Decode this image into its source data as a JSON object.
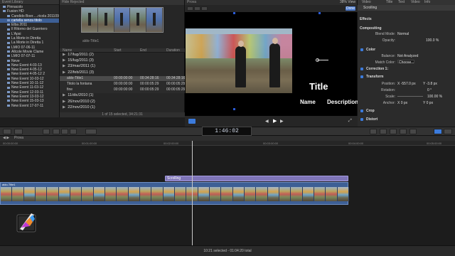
{
  "library": {
    "header": "Event Library",
    "items": [
      {
        "label": "Pinnacolo",
        "level": 1
      },
      {
        "label": "Fusion HD",
        "level": 1
      },
      {
        "label": "Candido Boer.....ricola 20110928",
        "level": 2
      },
      {
        "label": "cartella senza titolo",
        "level": 2,
        "selected": true
      },
      {
        "label": "Elba 2011",
        "level": 2
      },
      {
        "label": "Il Ritorno del Guerriero",
        "level": 2
      },
      {
        "label": "L'Apsi",
        "level": 2
      },
      {
        "label": "La Morte in Diretta",
        "level": 2
      },
      {
        "label": "La Morte in Diretta 1",
        "level": 2
      },
      {
        "label": "LMIO 07-06-11",
        "level": 2
      },
      {
        "label": "Allcole Movie Clame",
        "level": 2
      },
      {
        "label": "LMIO 07-07-11",
        "level": 2
      },
      {
        "label": "Neve",
        "level": 2
      },
      {
        "label": "New Event 4-03-13",
        "level": 2
      },
      {
        "label": "New Event 4-05-12",
        "level": 2
      },
      {
        "label": "New Event 4-05-12 2",
        "level": 2
      },
      {
        "label": "New Event 10-03-12",
        "level": 2
      },
      {
        "label": "New Event 10-11-12",
        "level": 2
      },
      {
        "label": "New Event 11-03-12",
        "level": 2
      },
      {
        "label": "New Event 12-03-11",
        "level": 2
      },
      {
        "label": "New Event 13-03-12",
        "level": 2
      },
      {
        "label": "New Event 15-03-13",
        "level": 2
      },
      {
        "label": "New Event 17-07-11",
        "level": 2
      }
    ]
  },
  "browser": {
    "header": "Hide Rejected",
    "filmstrip_label": "aldo-Title1",
    "columns": [
      "Name",
      "Start",
      "End",
      "Duration"
    ],
    "rows": [
      {
        "type": "date",
        "name": "17/lug/2011  (2)"
      },
      {
        "type": "date",
        "name": "15/lug/2011  (3)"
      },
      {
        "type": "date",
        "name": "23/mar/2011  (1)"
      },
      {
        "type": "date",
        "name": "22/feb/2011  (3)"
      },
      {
        "type": "clip",
        "name": "aldo-Title1",
        "start": "00:00:00:00",
        "end": "00:34:28:16",
        "duration": "00:34:28:16",
        "selected": true
      },
      {
        "type": "clip",
        "name": "Titolo la fontana",
        "start": "00:00:00:00",
        "end": "00:00:05:29",
        "duration": "00:00:05:29"
      },
      {
        "type": "clip",
        "name": "fine",
        "start": "00:00:00:00",
        "end": "00:00:05:29",
        "duration": "00:00:05:29"
      },
      {
        "type": "date",
        "name": "11/dic/2010  (1)"
      },
      {
        "type": "date",
        "name": "26/nov/2010  (2)"
      },
      {
        "type": "date",
        "name": "22/nov/2010  (1)"
      }
    ],
    "footer": "1 of 15 selected, 34:21:31"
  },
  "viewer": {
    "header": "Prova",
    "zoom": "38%",
    "view": "View",
    "done": "Done",
    "title_text": "Title",
    "name_text": "Name",
    "desc_text": "Description"
  },
  "inspector": {
    "tabs": [
      "Video",
      "Title",
      "Text",
      "Video",
      "Info"
    ],
    "clip_name": "Scrolling",
    "sections": {
      "effects": "Effects",
      "compositing": "Compositing",
      "blend_mode_label": "Blend Mode:",
      "blend_mode_value": "Normal",
      "opacity_label": "Opacity:",
      "opacity_value": "100.0 %",
      "color": "Color",
      "balance_label": "Balance:",
      "balance_value": "Not Analyzed",
      "match_color_label": "Match Color:",
      "match_color_value": "Choose...",
      "correction": "Correction 1:",
      "transform": "Transform",
      "position_label": "Position:",
      "position_x": "X  -557.0 px",
      "position_y": "Y  -3.8 px",
      "rotation_label": "Rotation:",
      "rotation_value": "0 °",
      "scale_label": "Scale:",
      "scale_value": "100.00 %",
      "anchor_label": "Anchor:",
      "anchor_x": "X  0 px",
      "anchor_y": "Y  0 px",
      "crop": "Crop",
      "distort": "Distort"
    }
  },
  "toolbar": {
    "timecode": "1:46:02"
  },
  "timeline": {
    "project": "Prova",
    "ruler": [
      "00:00:00:00",
      "00:01:00:00",
      "00:02:00:00",
      "00:03:00:00",
      "00:04:00:00",
      "00:05:00:00"
    ],
    "title_clip": "Scrolling",
    "story_clip": "aldo-Title1",
    "status": "10:21 selected - 01:04:20 total"
  },
  "colors": {
    "selection": "#3d5f95",
    "title_clip": "#7f75b8",
    "accent": "#4b78c9"
  }
}
